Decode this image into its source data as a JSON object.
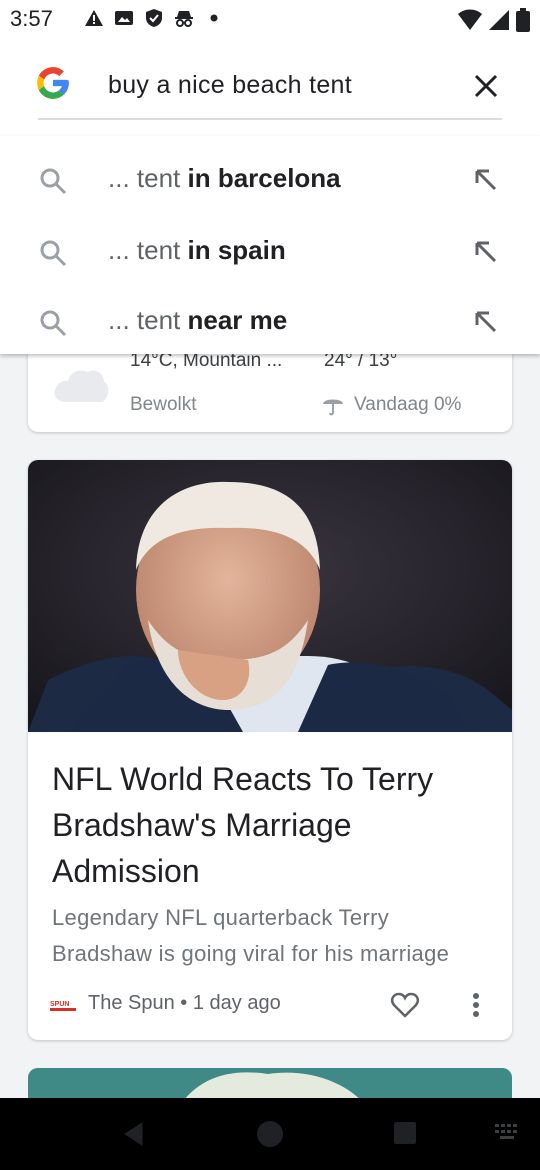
{
  "status_bar": {
    "time": "3:57",
    "left_icons": [
      "alert-icon",
      "gallery-icon",
      "shield-icon",
      "incognito-icon",
      "dot-icon"
    ],
    "right_icons": [
      "wifi-icon",
      "signal-icon",
      "battery-icon"
    ]
  },
  "search": {
    "query": "buy a nice beach tent",
    "clear_icon": "close-icon"
  },
  "suggestions": [
    {
      "prefix": "... tent",
      "completion": " in barcelona"
    },
    {
      "prefix": "... tent",
      "completion": " in spain"
    },
    {
      "prefix": "... tent",
      "completion": " near me"
    }
  ],
  "weather": {
    "current": "14°C, Mountain ...",
    "condition": "Bewolkt",
    "range": "24° / 13°",
    "rain": "Vandaag 0%"
  },
  "news": {
    "title": "NFL World Reacts To Terry Bradshaw's Marriage Admission",
    "snippet_line1": "Legendary NFL quarterback Terry",
    "snippet_line2": "Bradshaw is going viral for his marriage",
    "source_logo_text": "SPUN",
    "meta": "The Spun • 1 day ago"
  },
  "colors": {
    "google_blue": "#4285f4",
    "google_red": "#ea4335",
    "google_yellow": "#fbbc05",
    "google_green": "#34a853",
    "background": "#f1f3f4",
    "card": "#ffffff"
  },
  "nav_bar": {
    "icons": [
      "back-icon",
      "home-icon",
      "recents-icon",
      "keyboard-icon"
    ]
  }
}
